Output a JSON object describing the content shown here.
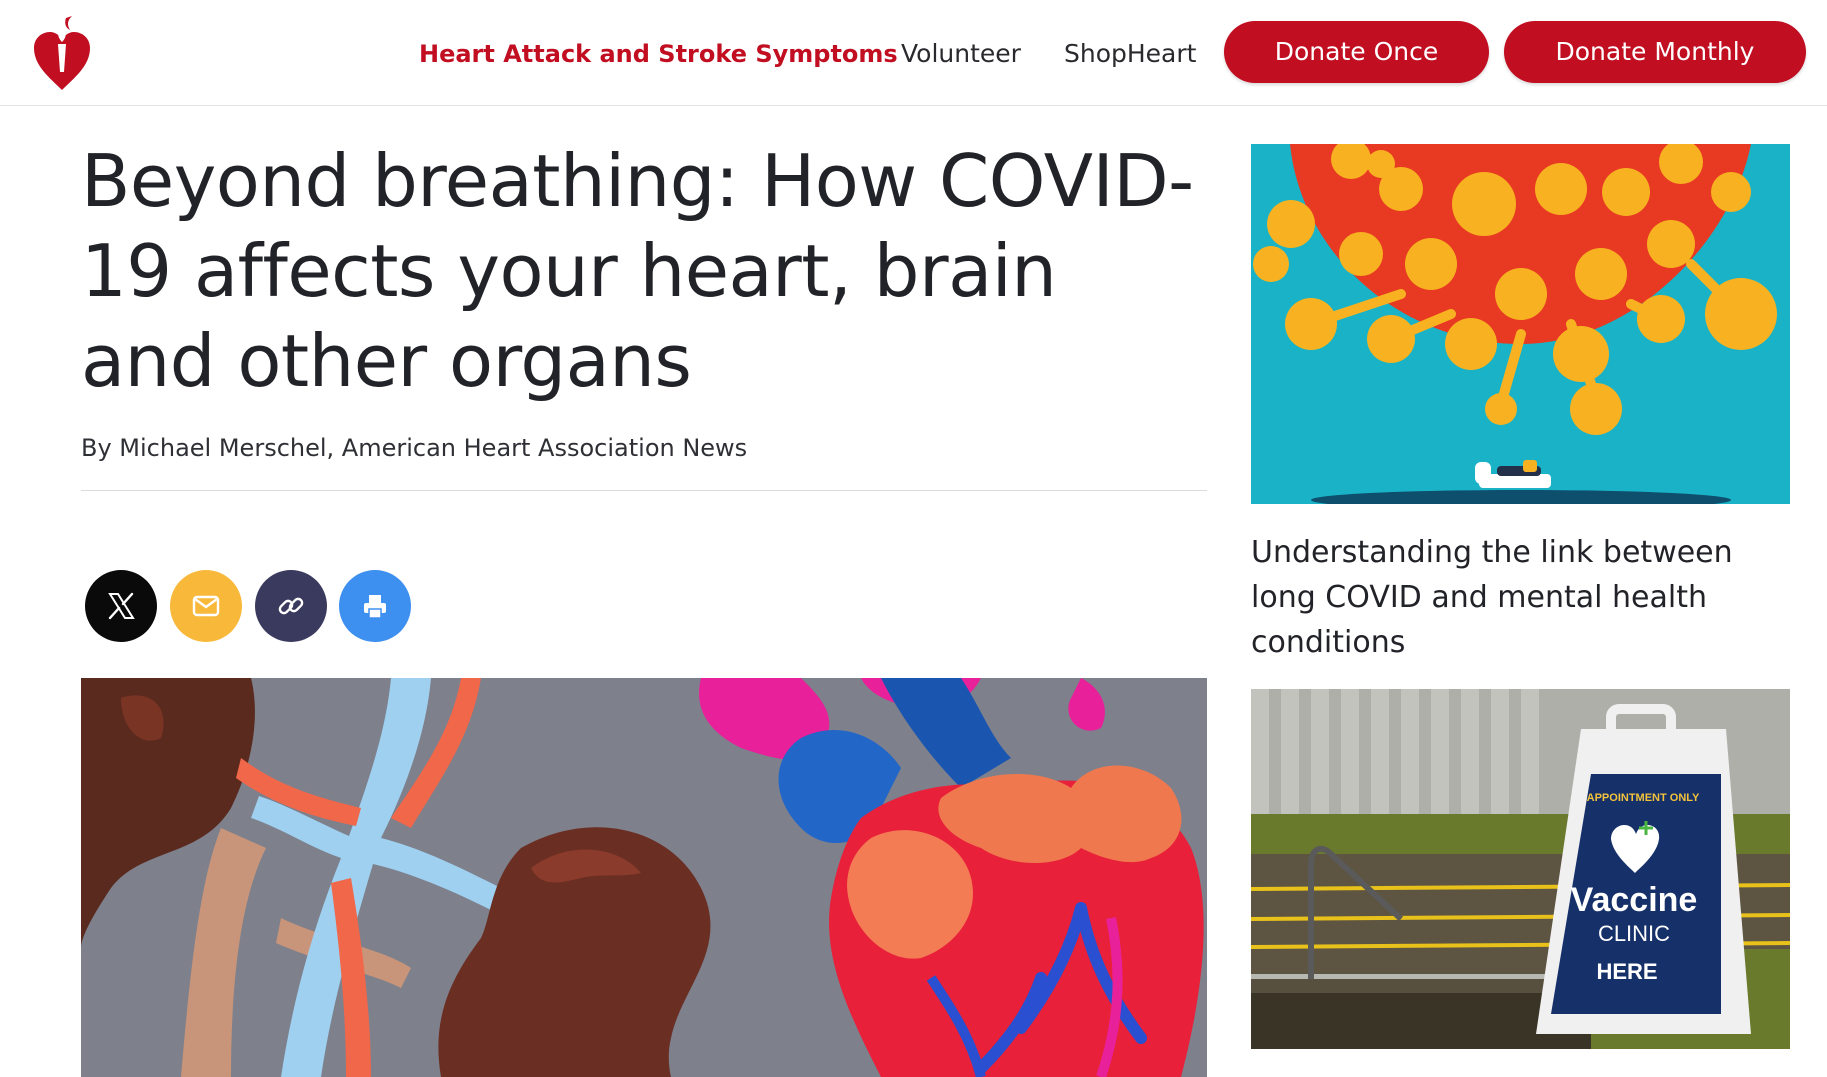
{
  "header": {
    "logo_alt": "American Heart Association logo",
    "nav": [
      {
        "label": "Heart Attack and Stroke Symptoms"
      },
      {
        "label": "Volunteer"
      },
      {
        "label": "ShopHeart"
      }
    ],
    "buttons": {
      "donate_once": "Donate Once",
      "donate_monthly": "Donate Monthly"
    }
  },
  "article": {
    "title": "Beyond breathing: How COVID-19 affects your heart, brain and other organs",
    "byline": "By Michael Merschel, American Heart Association News",
    "share": [
      {
        "icon": "x-icon"
      },
      {
        "icon": "email-icon"
      },
      {
        "icon": "link-icon"
      },
      {
        "icon": "print-icon"
      }
    ]
  },
  "sidebar": {
    "related": [
      {
        "caption": "Understanding the link between long COVID and mental health conditions"
      }
    ],
    "sign": {
      "top": "APPOINTMENT ONLY",
      "line1": "Vaccine",
      "line2": "CLINIC",
      "line3": "HERE"
    }
  },
  "colors": {
    "brand_red": "#c10e21",
    "share_x": "#0a0a0a",
    "share_email": "#f8b83a",
    "share_link": "#3a3a5e",
    "share_print": "#3d8ff0"
  }
}
